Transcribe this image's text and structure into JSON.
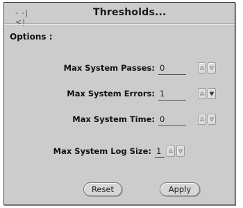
{
  "window": {
    "title": "Thresholds..."
  },
  "section": {
    "label": "Options :"
  },
  "fields": [
    {
      "label": "Max System Passes:",
      "value": "0"
    },
    {
      "label": "Max System Errors:",
      "value": "1"
    },
    {
      "label": "Max System Time:",
      "value": "0"
    },
    {
      "label": "Max System Log Size:",
      "value": "1"
    }
  ],
  "buttons": {
    "reset": "Reset",
    "apply": "Apply"
  }
}
